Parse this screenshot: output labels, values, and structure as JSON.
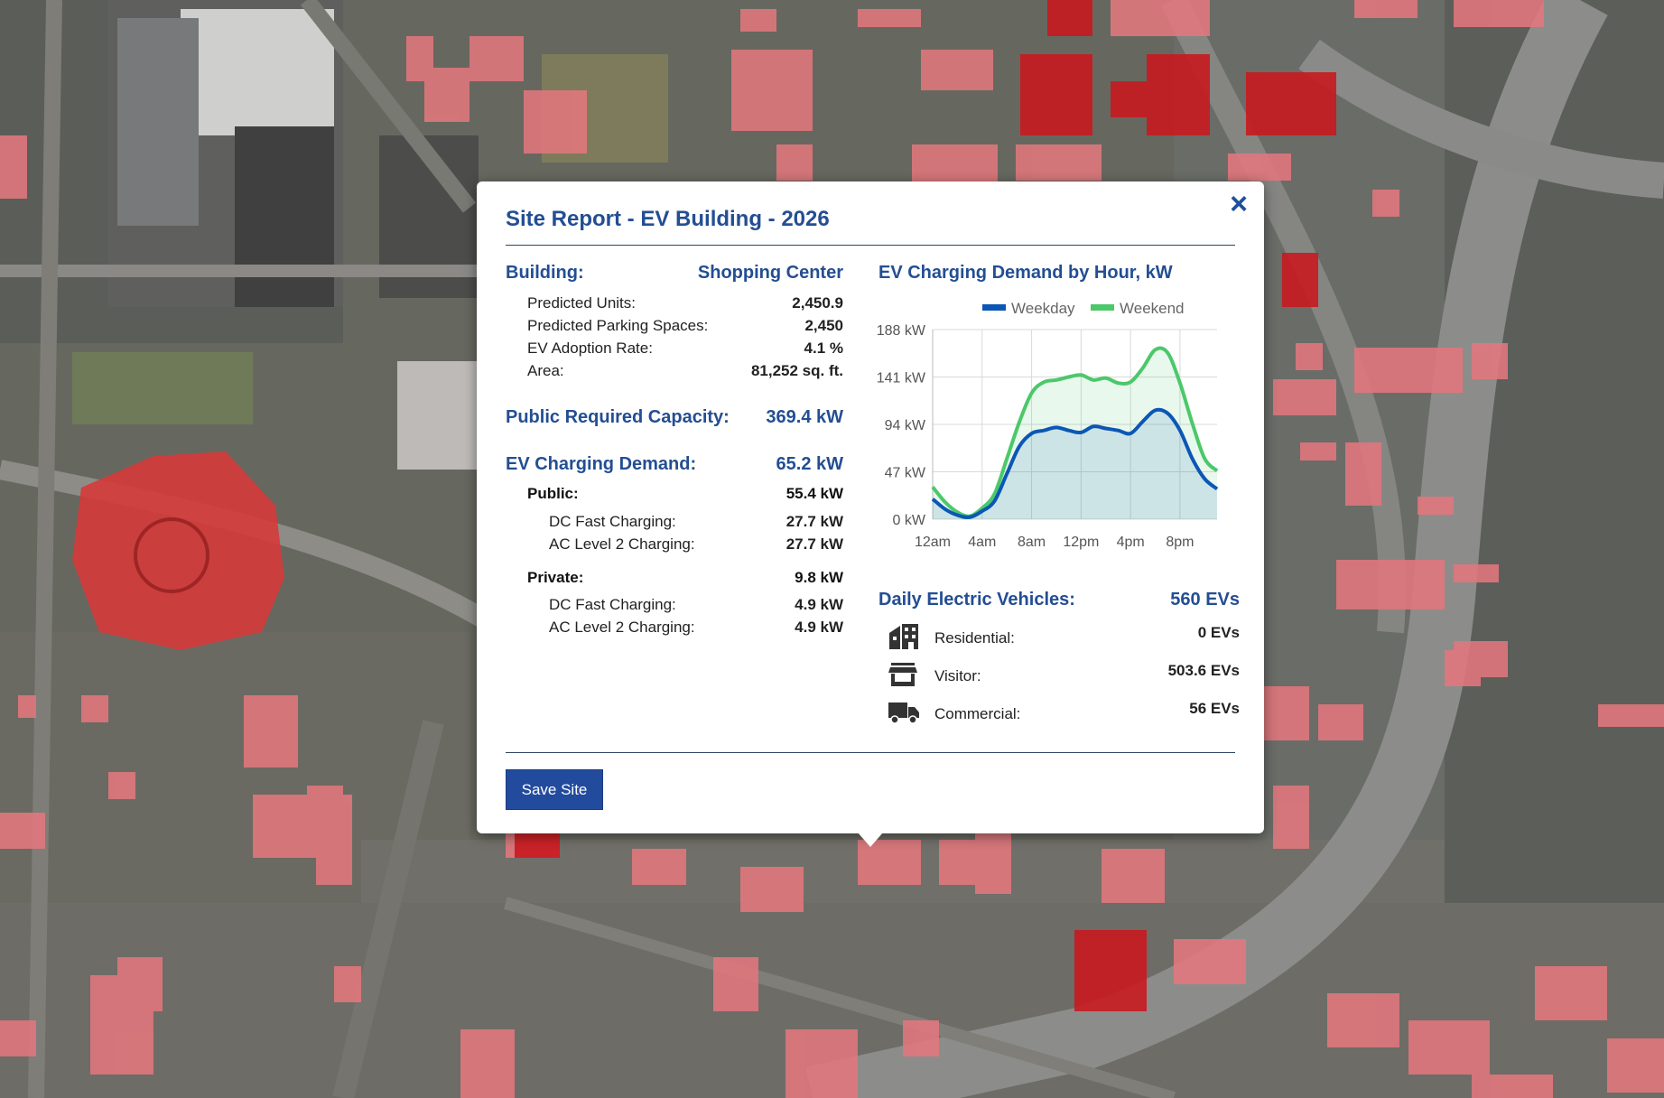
{
  "popup": {
    "title": "Site Report - EV Building - 2026",
    "close_label": "×",
    "save_label": "Save Site"
  },
  "building": {
    "label": "Building:",
    "type": "Shopping Center",
    "stats": [
      {
        "label": "Predicted Units:",
        "value": "2,450.9"
      },
      {
        "label": "Predicted Parking Spaces:",
        "value": "2,450"
      },
      {
        "label": "EV Adoption Rate:",
        "value": "4.1 %"
      },
      {
        "label": "Area:",
        "value": "81,252 sq. ft."
      }
    ]
  },
  "capacity": {
    "label": "Public Required Capacity:",
    "value": "369.4 kW"
  },
  "demand": {
    "label": "EV Charging Demand:",
    "value": "65.2 kW",
    "public": {
      "label": "Public:",
      "value": "55.4 kW",
      "dc_label": "DC Fast Charging:",
      "dc_value": "27.7 kW",
      "ac_label": "AC Level 2 Charging:",
      "ac_value": "27.7 kW"
    },
    "private": {
      "label": "Private:",
      "value": "9.8 kW",
      "dc_label": "DC Fast Charging:",
      "dc_value": "4.9 kW",
      "ac_label": "AC Level 2 Charging:",
      "ac_value": "4.9 kW"
    }
  },
  "chart_data": {
    "type": "area",
    "title": "EV Charging Demand by Hour, kW",
    "x": [
      0,
      1,
      2,
      3,
      4,
      5,
      6,
      7,
      8,
      9,
      10,
      11,
      12,
      13,
      14,
      15,
      16,
      17,
      18,
      19,
      20,
      21,
      22,
      23
    ],
    "xtick_labels": [
      "12am",
      "4am",
      "8am",
      "12pm",
      "4pm",
      "8pm"
    ],
    "xtick_positions": [
      0,
      4,
      8,
      12,
      16,
      20
    ],
    "ylim": [
      0,
      188
    ],
    "yticks": [
      0,
      47,
      94,
      141,
      188
    ],
    "ytick_labels": [
      "0 kW",
      "47 kW",
      "94 kW",
      "141 kW",
      "188 kW"
    ],
    "grid": true,
    "legend_placement": "top-center",
    "series": [
      {
        "name": "Weekday",
        "color": "#0b57b5",
        "values": [
          20,
          10,
          4,
          2,
          8,
          18,
          45,
          72,
          85,
          88,
          91,
          88,
          86,
          92,
          90,
          88,
          85,
          97,
          108,
          105,
          88,
          60,
          40,
          30
        ]
      },
      {
        "name": "Weekend",
        "color": "#4cc86a",
        "values": [
          32,
          17,
          7,
          3,
          11,
          25,
          60,
          96,
          125,
          136,
          138,
          141,
          143,
          138,
          140,
          135,
          136,
          150,
          168,
          165,
          135,
          95,
          60,
          48
        ]
      }
    ]
  },
  "vehicles": {
    "label": "Daily Electric Vehicles:",
    "total": "560 EVs",
    "rows": [
      {
        "icon": "building-icon",
        "label": "Residential:",
        "value": "0 EVs"
      },
      {
        "icon": "store-icon",
        "label": "Visitor:",
        "value": "503.6 EVs"
      },
      {
        "icon": "truck-icon",
        "label": "Commercial:",
        "value": "56 EVs"
      }
    ]
  },
  "colors": {
    "accent": "#234e93",
    "button": "#224b9d",
    "footprint_light": "#e2777d",
    "footprint_dark": "#c81a1f"
  }
}
